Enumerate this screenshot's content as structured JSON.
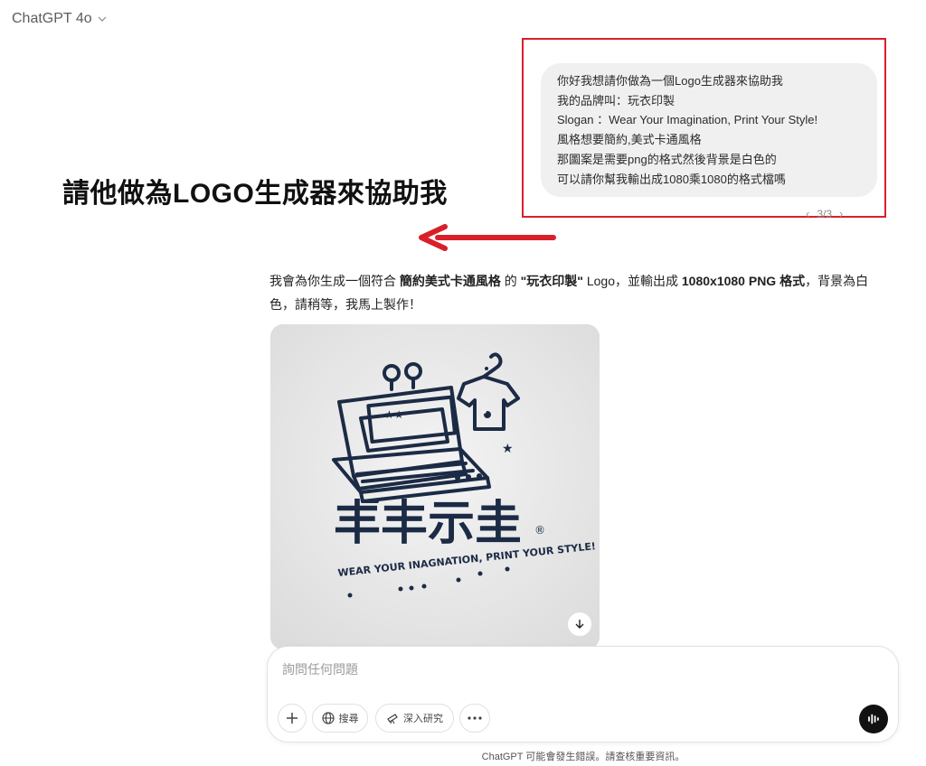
{
  "header": {
    "model_name": "ChatGPT 4o"
  },
  "user_message": {
    "lines": [
      "你好我想請你做為一個Logo生成器來協助我",
      "我的品牌叫：玩衣印製",
      "Slogan ：Wear Your Imagination, Print Your Style!",
      "風格想要簡約,美式卡通風格",
      "那圖案是需要png的格式然後背景是白色的",
      "可以請你幫我輸出成1080乘1080的格式檔嗎"
    ],
    "pager": {
      "text": "3/3",
      "prev": "‹",
      "next": "›"
    }
  },
  "annotation": {
    "text": "請他做為LOGO生成器來協助我",
    "color": "#d8202a"
  },
  "assistant_message": {
    "p1": "我會為你生成一個符合 ",
    "b1": "簡約美式卡通風格",
    "p2": " 的 ",
    "b2": "\"玩衣印製\"",
    "p3": " Logo，並輸出成 ",
    "b3": "1080x1080 PNG 格式",
    "p4": "，背景為白色，請稍等，我馬上製作！"
  },
  "generated_image": {
    "logo_glyphs": "丰丰示圭",
    "slogan": "WEAR YOUR INAGNATION, PRINT YOUR STYLE!",
    "registered_mark": "®"
  },
  "composer": {
    "placeholder": "詢問任何問題",
    "tools": {
      "search": "搜尋",
      "deep_research": "深入研究"
    }
  },
  "footer": {
    "disclaimer": "ChatGPT 可能會發生錯誤。請查核重要資訊。"
  }
}
